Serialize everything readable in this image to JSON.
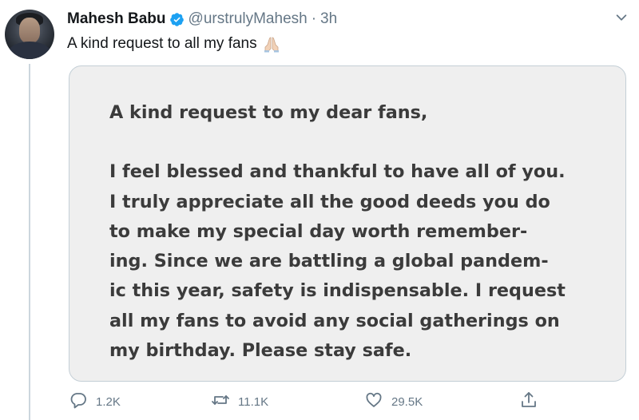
{
  "tweet": {
    "display_name": "Mahesh Babu",
    "handle": "@urstrulyMahesh",
    "separator": "·",
    "timestamp": "3h",
    "text": "A kind request to all my fans",
    "emoji_icon": "folded-hands-icon",
    "verified_icon": "verified-badge-icon",
    "menu_icon": "chevron-down-icon"
  },
  "media": {
    "greeting": "A kind request to my dear fans,",
    "lines": [
      "I feel blessed and thankful to have all of you.",
      "I truly appreciate all the good deeds you do",
      "to make my special day worth remember-",
      "ing. Since we are battling a global pandem-",
      "ic this year, safety is indispensable. I request",
      "all my fans to avoid any social gatherings on",
      "my birthday. Please stay safe."
    ]
  },
  "actions": {
    "reply_count": "1.2K",
    "retweet_count": "11.1K",
    "like_count": "29.5K",
    "icons": [
      "reply-icon",
      "retweet-icon",
      "like-icon",
      "share-icon"
    ]
  },
  "colors": {
    "verified": "#1da1f2",
    "muted_text": "#657786",
    "card_background": "#efefef"
  }
}
